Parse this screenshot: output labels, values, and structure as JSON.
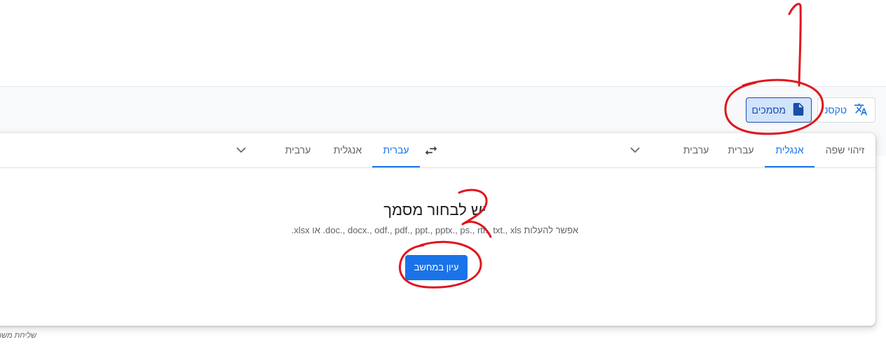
{
  "modes": {
    "text_label": "טקסט",
    "docs_label": "מסמכים"
  },
  "source_langs": [
    "זיהוי שפה",
    "אנגלית",
    "עברית",
    "ערבית"
  ],
  "target_langs": [
    "עברית",
    "אנגלית",
    "ערבית"
  ],
  "upload": {
    "title": "יש לבחור מסמך",
    "subtitle": "אפשר להעלות doc., docx., odf., pdf., ppt., pptx., ps., rtf., txt., xls. או xlsx.",
    "browse_label": "עיון במחשב"
  },
  "footer": {
    "feedback": "שליחת משוב"
  },
  "annotations": {
    "step1": "1",
    "step2": "2"
  },
  "colors": {
    "accent": "#1a73e8",
    "selected_bg": "#d2e3fc",
    "annotation": "#e0161e"
  },
  "icons": {
    "translate": "translate-icon",
    "document": "document-icon",
    "swap": "swap-icon",
    "chevron": "chevron-down-icon"
  }
}
